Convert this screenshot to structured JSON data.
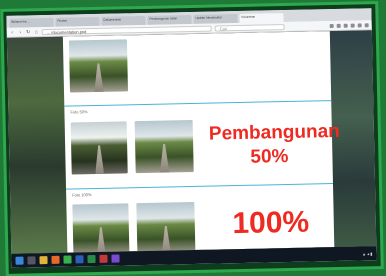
{
  "browser": {
    "tabs": [
      {
        "label": "Bulanan ke ...",
        "active": false
      },
      {
        "label": "Photos",
        "active": false
      },
      {
        "label": "Dokumentasi",
        "active": false
      },
      {
        "label": "Pembangunan Jalan",
        "active": false
      },
      {
        "label": "Update Infrastruktur",
        "active": false
      },
      {
        "label": "Kelurahan",
        "active": true
      }
    ],
    "url": "... /documentation.pnd",
    "search_placeholder": "Cari"
  },
  "page": {
    "sections": [
      {
        "caption": ""
      },
      {
        "caption": "Foto 50%",
        "headline_line1": "Pembangunan",
        "headline_line2": "50%"
      },
      {
        "caption": "Foto 100%",
        "headline": "100%"
      }
    ]
  },
  "colors": {
    "accent_red": "#ee2b22",
    "divider_blue": "#4bb3d8",
    "frame_green": "#2ea84c"
  }
}
